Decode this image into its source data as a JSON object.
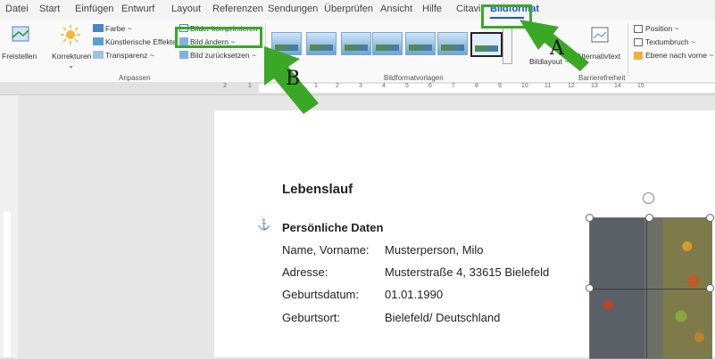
{
  "tabs": [
    "Datei",
    "Start",
    "Einfügen",
    "Entwurf",
    "Layout",
    "Referenzen",
    "Sendungen",
    "Überprüfen",
    "Ansicht",
    "Hilfe",
    "Citavi",
    "Bildformat"
  ],
  "ribbon": {
    "freistellen": "Freistellen",
    "korrekturen": "Korrekturen",
    "farbe": "Farbe ~",
    "kuenstlerische": "Künstlerische Effekte ~",
    "transparenz": "Transparenz ~",
    "komprimieren": "Bilder komprimieren",
    "aendern": "Bild ändern ~",
    "zuruecksetzen": "Bild zurücksetzen ~",
    "bildlayout": "Bildlayout ~",
    "alternativtext": "Alternativtext",
    "position": "Position ~",
    "textumbruch": "Textumbruch ~",
    "ebene": "Ebene nach vorne ~",
    "groups": {
      "anpassen": "Anpassen",
      "bildformatvorlagen": "Bildformatvorlagen",
      "barrierefreiheit": "Barrierefreiheit"
    }
  },
  "ruler": [
    "2",
    "1",
    "1",
    "2",
    "3",
    "4",
    "5",
    "6",
    "7",
    "8",
    "9",
    "10",
    "11",
    "12",
    "13",
    "14",
    "15"
  ],
  "document": {
    "heading": "Lebenslauf",
    "section": "Persönliche Daten",
    "rows": [
      {
        "label": "Name, Vorname:",
        "value": "Musterperson, Milo"
      },
      {
        "label": "Adresse:",
        "value": "Musterstraße 4, 33615 Bielefeld"
      },
      {
        "label": "Geburtsdatum:",
        "value": "01.01.1990"
      },
      {
        "label": "Geburtsort:",
        "value": "Bielefeld/ Deutschland"
      }
    ]
  },
  "annotations": {
    "a": "A",
    "b": "B"
  },
  "colors": {
    "accent": "#185abd",
    "highlight": "#3aa826"
  }
}
